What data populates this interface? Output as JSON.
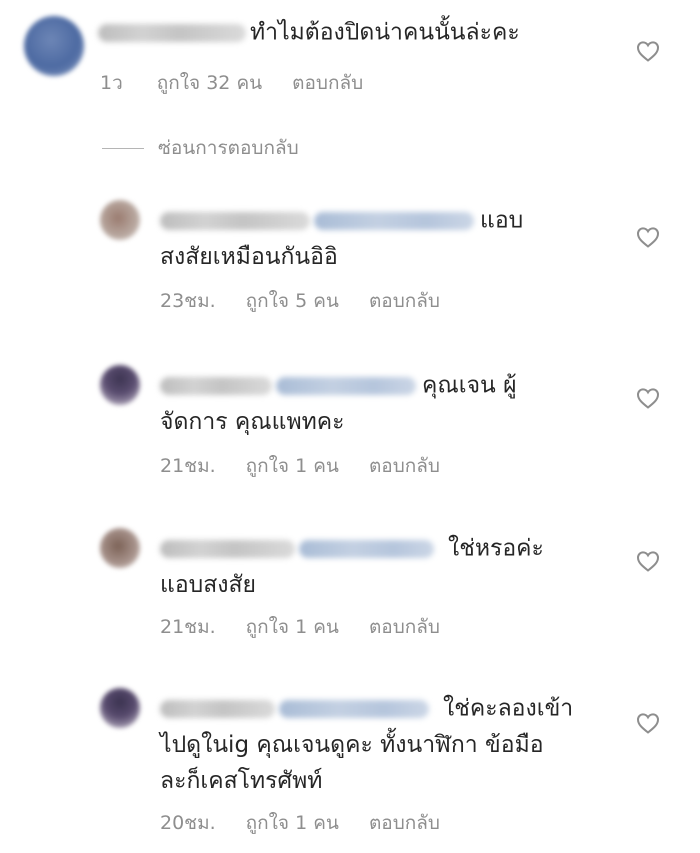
{
  "comment": {
    "text": "ทำไมต้องปิดน่าคนนั้นล่ะคะ",
    "time": "1ว",
    "likes": "ถูกใจ 32 คน",
    "reply": "ตอบกลับ"
  },
  "hide_replies_label": "ซ่อนการตอบกลับ",
  "replies": [
    {
      "line1": "แอบ",
      "line2": "สงสัยเหมือนกันอิอิ",
      "time": "23ชม.",
      "likes": "ถูกใจ 5 คน",
      "reply": "ตอบกลับ"
    },
    {
      "line1": "คุณเจน ผู้",
      "line2": "จัดการ คุณแพทคะ",
      "time": "21ชม.",
      "likes": "ถูกใจ 1 คน",
      "reply": "ตอบกลับ"
    },
    {
      "line1": "ใช่หรอค่ะ",
      "line2": "แอบสงสัย",
      "time": "21ชม.",
      "likes": "ถูกใจ 1 คน",
      "reply": "ตอบกลับ"
    },
    {
      "line1": "ใช่คะลองเข้า",
      "line2": "ไปดูในig คุณเจนดูคะ ทั้งนาฬิกา ข้อมือ",
      "line3": "ละก็เคสโทรศัพท์",
      "time": "20ชม.",
      "likes": "ถูกใจ 1 คน",
      "reply": "ตอบกลับ"
    }
  ],
  "icons": {
    "like": "heart-outline-icon"
  }
}
